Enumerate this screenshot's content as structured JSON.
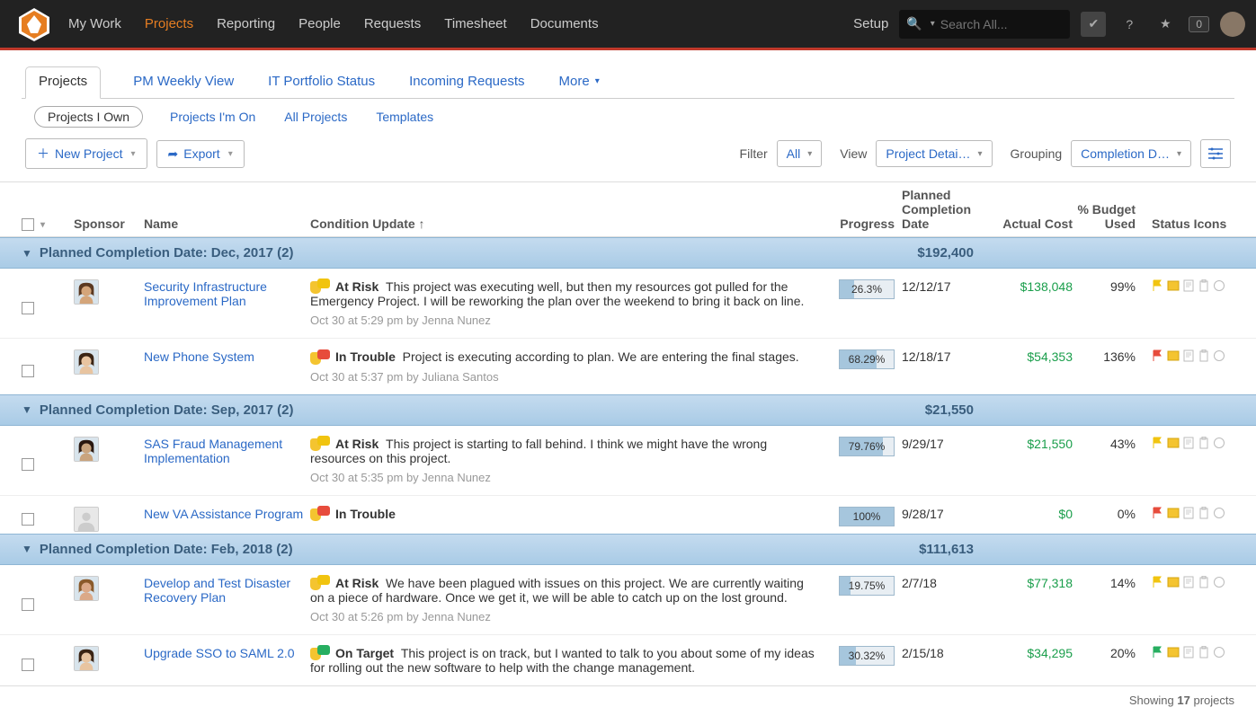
{
  "topnav": [
    "My Work",
    "Projects",
    "Reporting",
    "People",
    "Requests",
    "Timesheet",
    "Documents"
  ],
  "topnav_active": 1,
  "setup": "Setup",
  "search_placeholder": "Search All...",
  "notif_count": "0",
  "tabs": [
    {
      "label": "Projects",
      "active": true
    },
    {
      "label": "PM Weekly View"
    },
    {
      "label": "IT Portfolio Status"
    },
    {
      "label": "Incoming Requests"
    },
    {
      "label": "More",
      "dd": true
    }
  ],
  "subtabs": [
    {
      "label": "Projects I Own",
      "active": true
    },
    {
      "label": "Projects I'm On"
    },
    {
      "label": "All Projects"
    },
    {
      "label": "Templates"
    }
  ],
  "buttons": {
    "new": "New Project",
    "export": "Export"
  },
  "filterbar": {
    "filter": "Filter",
    "all": "All",
    "view": "View",
    "view_val": "Project Detai…",
    "grouping": "Grouping",
    "group_val": "Completion D…"
  },
  "headers": {
    "sponsor": "Sponsor",
    "name": "Name",
    "cond": "Condition Update",
    "cond_arrow": "↑",
    "progress": "Progress",
    "date": "Planned Completion Date",
    "cost": "Actual Cost",
    "budget": "% Budget Used",
    "icons": "Status Icons"
  },
  "groups": [
    {
      "title": "Planned Completion Date: Dec, 2017 (2)",
      "cost": "$192,400",
      "rows": [
        {
          "name": "Security Infrastructure Improvement Plan",
          "status": "At Risk",
          "status_color": "#f1c40f",
          "text": "This project was executing well, but then my resources got pulled for the Emergency Project. I will be reworking the plan over the weekend to bring it back on line.",
          "meta": "Oct 30 at 5:29 pm by Jenna Nunez",
          "progress": "26.3%",
          "prog_pct": 26.3,
          "date": "12/12/17",
          "cost": "$138,048",
          "budget": "99%",
          "av": "f1"
        },
        {
          "name": "New Phone System",
          "status": "In Trouble",
          "status_color": "#e74c3c",
          "text": "Project is executing according to plan. We are entering the final stages.",
          "meta": "Oct 30 at 5:37 pm by Juliana Santos",
          "progress": "68.29%",
          "prog_pct": 68.29,
          "date": "12/18/17",
          "cost": "$54,353",
          "budget": "136%",
          "av": "f2"
        }
      ]
    },
    {
      "title": "Planned Completion Date: Sep, 2017 (2)",
      "cost": "$21,550",
      "rows": [
        {
          "name": "SAS Fraud Management Implementation",
          "status": "At Risk",
          "status_color": "#f1c40f",
          "text": "This project is starting to fall behind. I think we might have the wrong resources on this project.",
          "meta": "Oct 30 at 5:35 pm by Jenna Nunez",
          "progress": "79.76%",
          "prog_pct": 79.76,
          "date": "9/29/17",
          "cost": "$21,550",
          "budget": "43%",
          "av": "f3"
        },
        {
          "name": "New VA Assistance Program",
          "status": "In Trouble",
          "status_color": "#e74c3c",
          "text": "",
          "meta": "",
          "progress": "100%",
          "prog_pct": 100,
          "date": "9/28/17",
          "cost": "$0",
          "budget": "0%",
          "av": "blank"
        }
      ]
    },
    {
      "title": "Planned Completion Date: Feb, 2018 (2)",
      "cost": "$111,613",
      "rows": [
        {
          "name": "Develop and Test Disaster Recovery Plan",
          "status": "At Risk",
          "status_color": "#f1c40f",
          "text": "We have been plagued with issues on this project. We are currently waiting on a piece of hardware. Once we get it, we will be able to catch up on the lost ground.",
          "meta": "Oct 30 at 5:26 pm by Jenna Nunez",
          "progress": "19.75%",
          "prog_pct": 19.75,
          "date": "2/7/18",
          "cost": "$77,318",
          "budget": "14%",
          "av": "f4"
        },
        {
          "name": "Upgrade SSO to SAML 2.0",
          "status": "On Target",
          "status_color": "#27ae60",
          "text": "This project is on track, but I wanted to talk to you about some of my ideas for rolling out the new software to help with the change management.",
          "meta": "",
          "progress": "30.32%",
          "prog_pct": 30.32,
          "date": "2/15/18",
          "cost": "$34,295",
          "budget": "20%",
          "av": "f2"
        }
      ]
    }
  ],
  "footer_prefix": "Showing",
  "footer_count": "17",
  "footer_suffix": "projects"
}
